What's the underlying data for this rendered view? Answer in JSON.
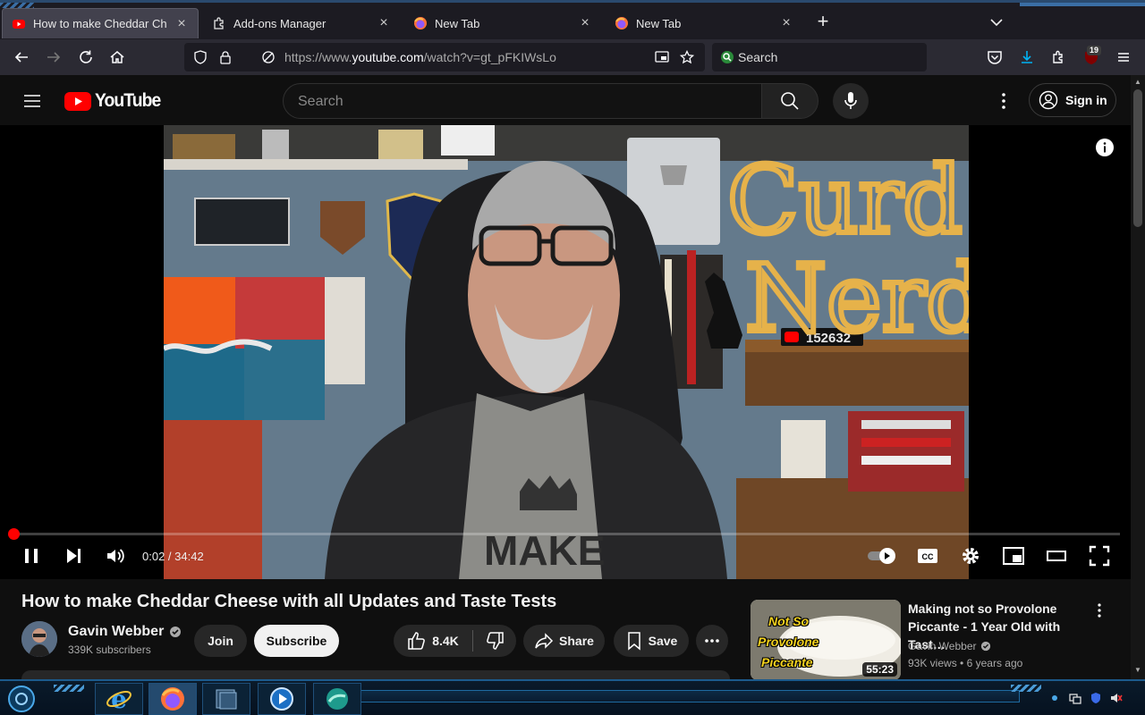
{
  "browser": {
    "tabs": [
      {
        "label": "How to make Cheddar Cheese with all Updates and Taste Tests - YouTube",
        "icon": "youtube-favicon",
        "active": true
      },
      {
        "label": "Add-ons Manager",
        "icon": "puzzle-icon",
        "active": false
      },
      {
        "label": "New Tab",
        "icon": "firefox-icon",
        "active": false
      },
      {
        "label": "New Tab",
        "icon": "firefox-icon",
        "active": false
      }
    ],
    "url_prefix": "https://www.",
    "url_domain": "youtube.com",
    "url_rest": "/watch?v=gt_pFKIWsLo",
    "search_placeholder": "Search",
    "extension_badge": "19"
  },
  "youtube": {
    "logo_text": "YouTube",
    "search_placeholder": "Search",
    "signin_label": "Sign in"
  },
  "player": {
    "time_current": "0:02",
    "time_total": "34:42",
    "time_display": "0:02 / 34:42",
    "progress_fraction": 0.001,
    "autoplay_on": true,
    "overlay_text": {
      "wall_sign_line1": "Curd",
      "wall_sign_line2": "Nerd",
      "counter": "152632",
      "shirt_text": "MAKE"
    }
  },
  "video": {
    "title": "How to make Cheddar Cheese with all Updates and Taste Tests",
    "channel_name": "Gavin Webber",
    "subscribers": "339K subscribers",
    "join_label": "Join",
    "subscribe_label": "Subscribe",
    "likes": "8.4K",
    "share_label": "Share",
    "save_label": "Save"
  },
  "recommendation": {
    "title": "Making not so Provolone Piccante - 1 Year Old with Tast…",
    "channel": "Gavin Webber",
    "views": "93K views",
    "age": "6 years ago",
    "meta_sep": "•",
    "duration": "55:23",
    "thumb_lines": [
      "Not So",
      "Provolone",
      "Piccante"
    ]
  },
  "colors": {
    "yt_red": "#ff0000",
    "bg": "#0f0f0f",
    "chip": "#272727",
    "firefox_toolbar": "#2b2a33",
    "download_accent": "#00b3f4"
  }
}
